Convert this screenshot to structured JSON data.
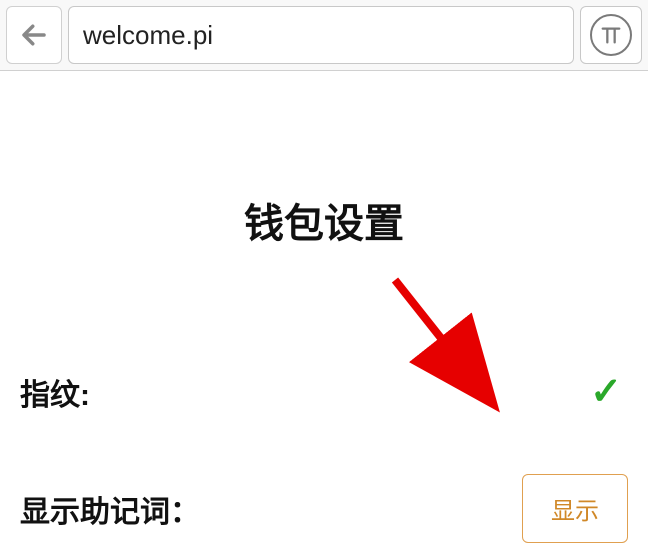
{
  "nav": {
    "url": "welcome.pi"
  },
  "page": {
    "title": "钱包设置"
  },
  "fingerprint": {
    "label": "指纹:",
    "status_icon": "check"
  },
  "mnemonic": {
    "label": "显示助记词：",
    "button_label": "显示"
  }
}
